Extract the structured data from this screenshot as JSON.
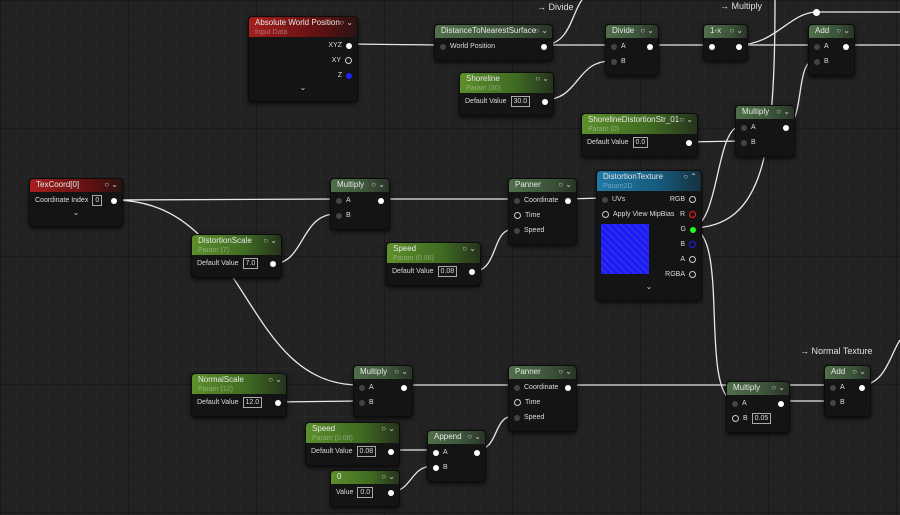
{
  "annotations": {
    "divide": "→ Divide",
    "multiply": "→ Multiply",
    "normal_texture": "→ Normal Texture"
  },
  "colors": {
    "input_header": "#a51f1f",
    "param_header": "#5d8f2c",
    "func_header": "#506f4a",
    "texture_header": "#1f78a5",
    "pin_r": "#ff2020",
    "pin_g": "#20ff20",
    "pin_b": "#2020ff"
  },
  "icons": {
    "preview_toggle": "circle-icon",
    "collapse": "chevron-down-icon",
    "expand": "chevron-up-icon"
  },
  "nodes": [
    {
      "id": "abs-world-position",
      "title": "Absolute World Position",
      "subtitle": "Input Data",
      "kind": "input",
      "expand": true,
      "rows": [
        {
          "out": "XYZ"
        },
        {
          "out": "XY",
          "outHollow": true
        },
        {
          "out": "Z",
          "outColor": "#2020ff"
        }
      ]
    },
    {
      "id": "distance-to-nearest-surface",
      "title": "DistanceToNearestSurface",
      "kind": "func",
      "rows": [
        {
          "in": "World Position",
          "out": ""
        }
      ]
    },
    {
      "id": "shoreline",
      "title": "Shoreline",
      "subtitle": "Param (30)",
      "kind": "param",
      "rows": [
        {
          "label": "Default Value",
          "value": "30.0",
          "out": ""
        }
      ]
    },
    {
      "id": "divide",
      "title": "Divide",
      "kind": "func",
      "rows": [
        {
          "in": "A",
          "out": ""
        },
        {
          "in": "B"
        }
      ]
    },
    {
      "id": "one-minus",
      "title": "1-x",
      "kind": "func",
      "rows": [
        {
          "in": "",
          "inWhite": true,
          "out": ""
        }
      ]
    },
    {
      "id": "add-top",
      "title": "Add",
      "kind": "func",
      "rows": [
        {
          "in": "A",
          "out": ""
        },
        {
          "in": "B"
        }
      ]
    },
    {
      "id": "multiply-top",
      "title": "Multiply",
      "kind": "func",
      "rows": [
        {
          "in": "A",
          "out": ""
        },
        {
          "in": "B"
        }
      ]
    },
    {
      "id": "shoreline-distortion-str",
      "title": "ShorelineDistortionStr_01",
      "subtitle": "Param (0)",
      "kind": "param",
      "rows": [
        {
          "label": "Default Value",
          "value": "0.0",
          "out": ""
        }
      ]
    },
    {
      "id": "texcoord",
      "title": "TexCoord[0]",
      "kind": "input",
      "expand": true,
      "rows": [
        {
          "label": "Coordinate Index",
          "value": "0",
          "out": ""
        }
      ]
    },
    {
      "id": "multiply-mid",
      "title": "Multiply",
      "kind": "func",
      "rows": [
        {
          "in": "A",
          "out": ""
        },
        {
          "in": "B"
        }
      ]
    },
    {
      "id": "distortion-scale",
      "title": "DistortionScale",
      "subtitle": "Param (7)",
      "kind": "param",
      "rows": [
        {
          "label": "Default Value",
          "value": "7.0",
          "out": ""
        }
      ]
    },
    {
      "id": "panner-mid",
      "title": "Panner",
      "kind": "func",
      "rows": [
        {
          "in": "Coordinate",
          "out": ""
        },
        {
          "in": "Time",
          "inHollow": true
        },
        {
          "in": "Speed"
        }
      ]
    },
    {
      "id": "speed-mid",
      "title": "Speed",
      "subtitle": "Param (0.08)",
      "kind": "param",
      "rows": [
        {
          "label": "Default Value",
          "value": "0.08",
          "out": ""
        }
      ]
    },
    {
      "id": "distortion-texture",
      "title": "DistortionTexture",
      "subtitle": "Param2D",
      "kind": "tex",
      "expand": true,
      "preview": true,
      "rows": [
        {
          "in": "UVs",
          "out": "RGB",
          "outHollow": true
        },
        {
          "in": "Apply View MipBias",
          "inHollow": true,
          "out": "R",
          "outHollow": true,
          "outColor": "#ff2020"
        },
        {
          "out": "G",
          "outColor": "#20ff20"
        },
        {
          "out": "B",
          "outHollow": true,
          "outColor": "#2020ff"
        },
        {
          "out": "A",
          "outHollow": true
        },
        {
          "out": "RGBA",
          "outHollow": true
        }
      ]
    },
    {
      "id": "normal-scale",
      "title": "NormalScale",
      "subtitle": "Param (12)",
      "kind": "param",
      "rows": [
        {
          "label": "Default Value",
          "value": "12.0",
          "out": ""
        }
      ]
    },
    {
      "id": "multiply-low",
      "title": "Multiply",
      "kind": "func",
      "rows": [
        {
          "in": "A",
          "out": ""
        },
        {
          "in": "B"
        }
      ]
    },
    {
      "id": "panner-low",
      "title": "Panner",
      "kind": "func",
      "rows": [
        {
          "in": "Coordinate",
          "out": ""
        },
        {
          "in": "Time",
          "inHollow": true
        },
        {
          "in": "Speed"
        }
      ]
    },
    {
      "id": "speed-low",
      "title": "Speed",
      "subtitle": "Param (0.08)",
      "kind": "param",
      "rows": [
        {
          "label": "Default Value",
          "value": "0.08",
          "out": ""
        }
      ]
    },
    {
      "id": "append",
      "title": "Append",
      "kind": "func",
      "rows": [
        {
          "in": "A",
          "inWhite": true,
          "out": ""
        },
        {
          "in": "B",
          "inWhite": true
        }
      ]
    },
    {
      "id": "constant-zero",
      "title": "0",
      "kind": "param",
      "rows": [
        {
          "label": "Value",
          "value": "0.0",
          "out": ""
        }
      ]
    },
    {
      "id": "multiply-right",
      "title": "Multiply",
      "kind": "func",
      "rows": [
        {
          "in": "A",
          "out": ""
        },
        {
          "in": "B",
          "inHollow": true,
          "value": "0.05"
        }
      ]
    },
    {
      "id": "add-low",
      "title": "Add",
      "kind": "func",
      "rows": [
        {
          "in": "A",
          "out": ""
        },
        {
          "in": "B"
        }
      ]
    }
  ]
}
